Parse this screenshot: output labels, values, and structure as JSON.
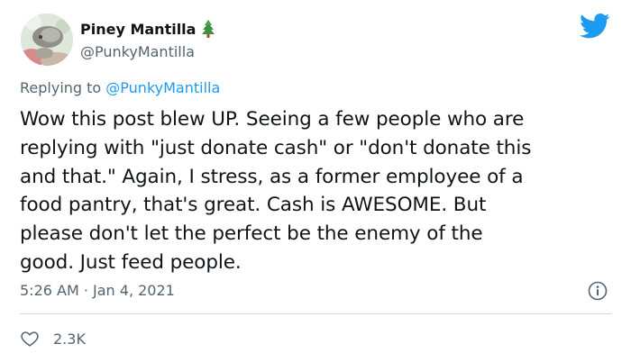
{
  "author": {
    "display_name": "Piney Mantilla",
    "name_emoji_icon": "evergreen-tree-icon",
    "handle": "@PunkyMantilla"
  },
  "platform_icon": "twitter-bird-icon",
  "reply": {
    "prefix": "Replying to",
    "mention": "@PunkyMantilla"
  },
  "tweet": {
    "lines": [
      "Wow this post blew UP. Seeing a few people who are",
      "replying with \"just donate cash\" or \"don't donate this",
      "and that.\" Again, I stress, as a former employee of a",
      "food pantry, that's great. Cash is AWESOME. But",
      "please don't let the perfect be the enemy of the",
      "good. Just feed people."
    ]
  },
  "meta": {
    "timestamp": "5:26 AM · Jan 4, 2021",
    "info_icon": "info-icon"
  },
  "engagement": {
    "like_icon": "heart-icon",
    "like_count": "2.3K"
  },
  "colors": {
    "text": "#0f1419",
    "secondary": "#536471",
    "accent": "#1d9bf0",
    "divider": "#cfd9de"
  }
}
